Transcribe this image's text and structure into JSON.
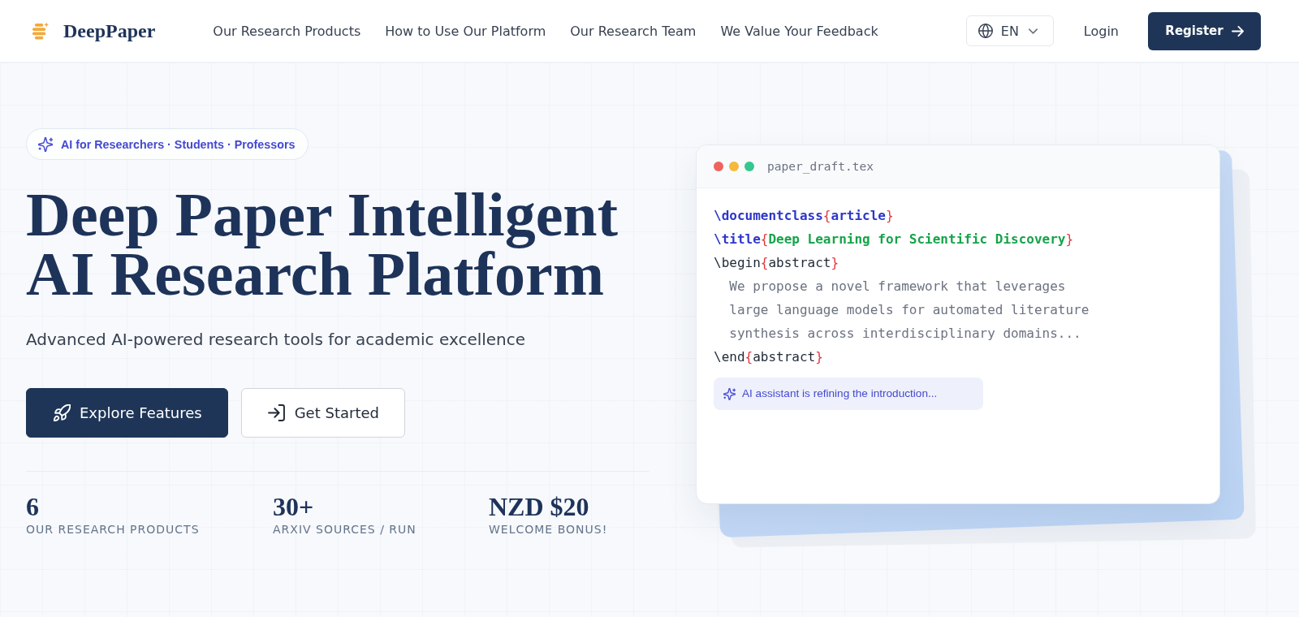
{
  "header": {
    "logo_text": "DeepPaper",
    "nav": [
      "Our Research Products",
      "How to Use Our Platform",
      "Our Research Team",
      "We Value Your Feedback"
    ],
    "language": "EN",
    "login": "Login",
    "register": "Register"
  },
  "hero": {
    "badge": "AI for Researchers · Students · Professors",
    "title_lines": [
      "Deep Paper Intelligent",
      "AI Research Platform"
    ],
    "subtitle": "Advanced AI-powered research tools for academic excellence",
    "buttons": [
      {
        "label": "Explore Features",
        "kind": "primary"
      },
      {
        "label": "Get Started",
        "kind": "secondary"
      }
    ],
    "stats": [
      {
        "value": "6",
        "label": "OUR RESEARCH PRODUCTS"
      },
      {
        "value": "30+",
        "label": "ARXIV SOURCES / RUN"
      },
      {
        "value": "NZD $20",
        "label": "WELCOME BONUS!"
      }
    ]
  },
  "editor": {
    "window_dots": [
      {
        "color": "#f0625c"
      },
      {
        "color": "#f6b93b"
      },
      {
        "color": "#34c78f"
      }
    ],
    "filename": "paper_draft.tex",
    "lines": [
      {
        "kind": "code",
        "tokens": [
          {
            "text": "\\documentclass",
            "kind": "keyword"
          },
          {
            "text": "{",
            "kind": "brace"
          },
          {
            "text": "article",
            "kind": "keyword"
          },
          {
            "text": "}",
            "kind": "brace"
          }
        ]
      },
      {
        "kind": "code",
        "tokens": [
          {
            "text": "\\title",
            "kind": "keyword"
          },
          {
            "text": "{",
            "kind": "brace"
          },
          {
            "text": "Deep Learning for Scientific Discovery",
            "kind": "string"
          },
          {
            "text": "}",
            "kind": "brace"
          }
        ]
      },
      {
        "kind": "code",
        "tokens": [
          {
            "text": "\\begin",
            "kind": "plain"
          },
          {
            "text": "{",
            "kind": "brace"
          },
          {
            "text": "abstract",
            "kind": "plain"
          },
          {
            "text": "}",
            "kind": "brace"
          }
        ]
      },
      {
        "kind": "prose",
        "tokens": [
          {
            "text": "We propose a novel framework that leverages",
            "kind": "comment"
          }
        ]
      },
      {
        "kind": "prose",
        "tokens": [
          {
            "text": "large language models for automated literature",
            "kind": "comment"
          }
        ]
      },
      {
        "kind": "prose",
        "tokens": [
          {
            "text": "synthesis across interdisciplinary domains...",
            "kind": "comment"
          }
        ]
      },
      {
        "kind": "code",
        "tokens": [
          {
            "text": "\\end",
            "kind": "plain"
          },
          {
            "text": "{",
            "kind": "brace"
          },
          {
            "text": "abstract",
            "kind": "plain"
          },
          {
            "text": "}",
            "kind": "brace"
          }
        ]
      }
    ],
    "assistant_note": "AI assistant is refining the introduction..."
  }
}
